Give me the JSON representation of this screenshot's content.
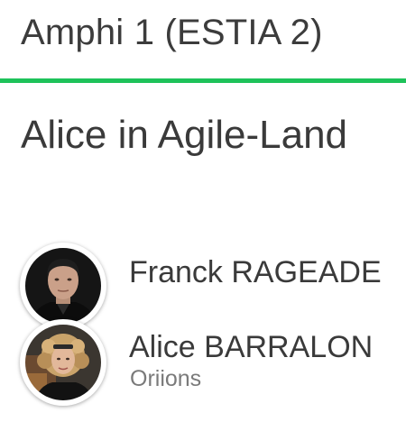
{
  "room": {
    "title": "Amphi 1 (ESTIA 2)",
    "accent_color": "#1ec25a"
  },
  "talk": {
    "title": "Alice in Agile-Land"
  },
  "speakers": [
    {
      "name": "Franck RAGEADE",
      "company": ""
    },
    {
      "name": "Alice BARRALON",
      "company": "Oriions"
    }
  ]
}
